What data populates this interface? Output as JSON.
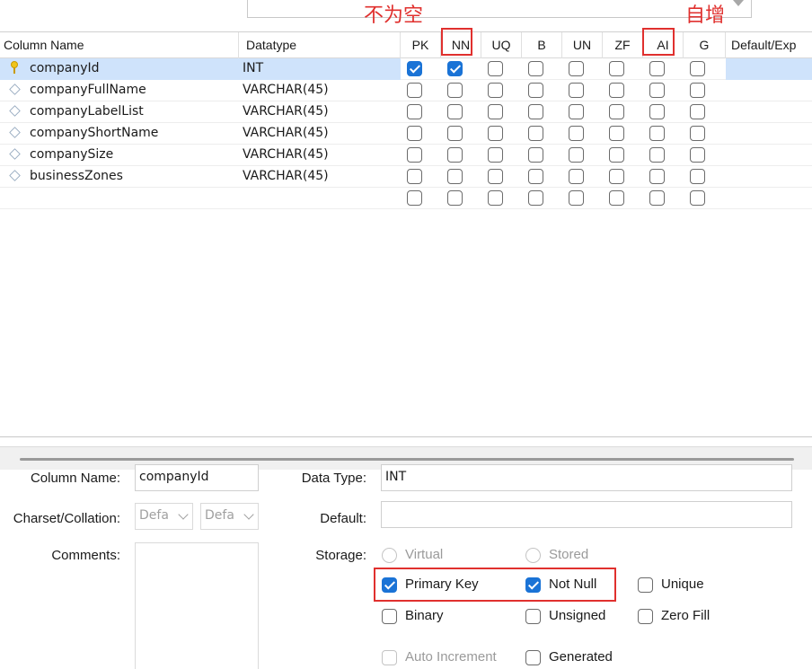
{
  "annotations": {
    "not_null_note": "不为空",
    "auto_increment_note": "自增"
  },
  "grid": {
    "headers": {
      "column_name": "Column Name",
      "datatype": "Datatype",
      "pk": "PK",
      "nn": "NN",
      "uq": "UQ",
      "b": "B",
      "un": "UN",
      "zf": "ZF",
      "ai": "AI",
      "g": "G",
      "default": "Default/Exp"
    },
    "rows": [
      {
        "name": "companyId",
        "type": "INT",
        "pk": true,
        "nn": true,
        "uq": false,
        "b": false,
        "un": false,
        "zf": false,
        "ai": false,
        "g": false,
        "selected": true,
        "icon": "primary-key-icon"
      },
      {
        "name": "companyFullName",
        "type": "VARCHAR(45)",
        "pk": false,
        "nn": false,
        "uq": false,
        "b": false,
        "un": false,
        "zf": false,
        "ai": false,
        "g": false,
        "icon": "column-diamond-icon"
      },
      {
        "name": "companyLabelList",
        "type": "VARCHAR(45)",
        "pk": false,
        "nn": false,
        "uq": false,
        "b": false,
        "un": false,
        "zf": false,
        "ai": false,
        "g": false,
        "icon": "column-diamond-icon"
      },
      {
        "name": "companyShortName",
        "type": "VARCHAR(45)",
        "pk": false,
        "nn": false,
        "uq": false,
        "b": false,
        "un": false,
        "zf": false,
        "ai": false,
        "g": false,
        "icon": "column-diamond-icon"
      },
      {
        "name": "companySize",
        "type": "VARCHAR(45)",
        "pk": false,
        "nn": false,
        "uq": false,
        "b": false,
        "un": false,
        "zf": false,
        "ai": false,
        "g": false,
        "icon": "column-diamond-icon"
      },
      {
        "name": "businessZones",
        "type": "VARCHAR(45)",
        "pk": false,
        "nn": false,
        "uq": false,
        "b": false,
        "un": false,
        "zf": false,
        "ai": false,
        "g": false,
        "icon": "column-diamond-icon"
      },
      {
        "name": "",
        "type": "",
        "pk": false,
        "nn": false,
        "uq": false,
        "b": false,
        "un": false,
        "zf": false,
        "ai": false,
        "g": false,
        "icon": ""
      }
    ]
  },
  "details": {
    "column_name_label": "Column Name:",
    "column_name_value": "companyId",
    "charset_label": "Charset/Collation:",
    "charset_value": "Defa",
    "collation_value": "Defa",
    "comments_label": "Comments:",
    "data_type_label": "Data Type:",
    "data_type_value": "INT",
    "default_label": "Default:",
    "default_value": "",
    "storage_label": "Storage:",
    "virtual_label": "Virtual",
    "stored_label": "Stored",
    "primary_key_label": "Primary Key",
    "not_null_label": "Not Null",
    "unique_label": "Unique",
    "binary_label": "Binary",
    "unsigned_label": "Unsigned",
    "zero_fill_label": "Zero Fill",
    "auto_increment_label": "Auto Increment",
    "generated_label": "Generated",
    "flags": {
      "primary_key": true,
      "not_null": true,
      "unique": false,
      "binary": false,
      "unsigned": false,
      "zero_fill": false,
      "auto_increment": false,
      "generated": false
    }
  },
  "colors": {
    "accent": "#1a73d6",
    "annotation": "#e0302e",
    "selection": "#cfe3fb"
  }
}
